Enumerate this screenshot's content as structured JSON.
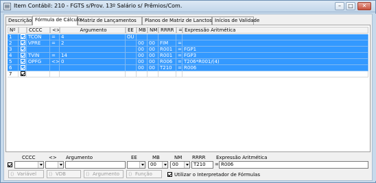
{
  "window": {
    "title": "Item Contábil: 210 - FGTS s/Prov. 13º Salário s/ Prêmios/Com.",
    "minimize": "–",
    "maximize": "□",
    "close": "✕"
  },
  "tabs": [
    {
      "label": "Descrição"
    },
    {
      "label": "Fórmula de Cálculo"
    },
    {
      "label": "Matriz de Lançamentos"
    },
    {
      "label": "Planos de Matriz de Lanctos"
    },
    {
      "label": "Inícios de Validade"
    }
  ],
  "grid": {
    "columns": [
      "Nº",
      "",
      "CCCC",
      "<>",
      "Argumento",
      "EE",
      "MB",
      "NM",
      "RRRR",
      "=",
      "Expressão Aritmética"
    ],
    "rows": [
      {
        "n": "1",
        "checked": true,
        "cccc": "TCON",
        "op": "=",
        "arg": "4",
        "ee": "OU",
        "mb": "",
        "nm": "",
        "rrrr": "",
        "eq": "",
        "expr": "",
        "selected": true
      },
      {
        "n": "2",
        "checked": true,
        "cccc": "VPRE",
        "op": "=",
        "arg": "2",
        "ee": "",
        "mb": "00",
        "nm": "00",
        "rrrr": "FIM",
        "eq": "=",
        "expr": "",
        "selected": true
      },
      {
        "n": "3",
        "checked": true,
        "cccc": "",
        "op": "",
        "arg": "",
        "ee": "",
        "mb": "00",
        "nm": "00",
        "rrrr": "R001",
        "eq": "=",
        "expr": "FGP1",
        "selected": true
      },
      {
        "n": "4",
        "checked": true,
        "cccc": "TVIN",
        "op": "=",
        "arg": "14",
        "ee": "",
        "mb": "00",
        "nm": "00",
        "rrrr": "R001",
        "eq": "=",
        "expr": "FGP3",
        "selected": true
      },
      {
        "n": "5",
        "checked": true,
        "cccc": "OPFG",
        "op": "<>",
        "arg": "0",
        "ee": "",
        "mb": "00",
        "nm": "00",
        "rrrr": "R006",
        "eq": "=",
        "expr": "T206*R001/(4)",
        "selected": true
      },
      {
        "n": "6",
        "checked": true,
        "cccc": "",
        "op": "",
        "arg": "",
        "ee": "",
        "mb": "00",
        "nm": "00",
        "rrrr": "T210",
        "eq": "=",
        "expr": "R006",
        "selected": true
      },
      {
        "n": "7",
        "checked": true,
        "cccc": "",
        "op": "",
        "arg": "",
        "ee": "",
        "mb": "",
        "nm": "",
        "rrrr": "",
        "eq": "",
        "expr": "",
        "selected": false
      }
    ]
  },
  "editor": {
    "labels": {
      "cccc": "CCCC",
      "op": "<>",
      "arg": "Argumento",
      "ee": "EE",
      "mb": "MB",
      "nm": "NM",
      "rrrr": "RRRR",
      "expr": "Expressão Aritmética"
    },
    "values": {
      "cccc": "",
      "op": "",
      "arg": "",
      "ee": "",
      "mb": "00",
      "nm": "00",
      "rrrr": "T210",
      "eq": "=",
      "expr": "R006"
    },
    "row_checked": true,
    "buttons": {
      "variavel": "Variável",
      "vdb": "VDB",
      "argumento": "Argumento",
      "funcao": "Função"
    },
    "use_interpreter_label": "Utilizar o Interpretador de Fórmulas",
    "use_interpreter_checked": true
  }
}
